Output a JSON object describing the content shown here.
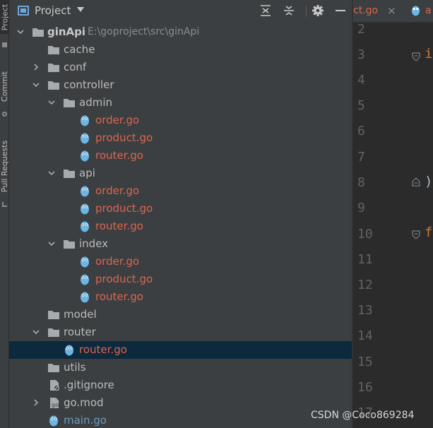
{
  "sidebar": {
    "tabs": [
      {
        "label": "Project",
        "active": true
      },
      {
        "label": "Commit",
        "active": false
      },
      {
        "label": "Pull Requests",
        "active": false
      }
    ]
  },
  "project_panel": {
    "title": "Project",
    "buttons": [
      "collapse-all",
      "expand-all",
      "settings",
      "hide"
    ]
  },
  "tree": {
    "root": {
      "name": "ginApi",
      "path": "E:\\goproject\\src\\ginApi"
    },
    "items": [
      {
        "name": "cache"
      },
      {
        "name": "conf"
      },
      {
        "name": "controller"
      },
      {
        "name": "admin"
      },
      {
        "name": "order.go"
      },
      {
        "name": "product.go"
      },
      {
        "name": "router.go"
      },
      {
        "name": "api"
      },
      {
        "name": "order.go"
      },
      {
        "name": "product.go"
      },
      {
        "name": "router.go"
      },
      {
        "name": "index"
      },
      {
        "name": "order.go"
      },
      {
        "name": "product.go"
      },
      {
        "name": "router.go"
      },
      {
        "name": "model"
      },
      {
        "name": "router"
      },
      {
        "name": "router.go",
        "selected": true
      },
      {
        "name": "utils"
      },
      {
        "name": ".gitignore"
      },
      {
        "name": "go.mod"
      },
      {
        "name": "main.go"
      }
    ]
  },
  "editor": {
    "tabs": [
      {
        "label": "ct.go",
        "close": "×"
      },
      {
        "label": "a"
      }
    ],
    "line_numbers": [
      "2",
      "3",
      "4",
      "5",
      "6",
      "7",
      "8",
      "9",
      "10",
      "11",
      "12",
      "13",
      "14",
      "15",
      "16",
      "17"
    ],
    "code_fragments": {
      "line3": "i",
      "line8": ")",
      "line10": "f"
    }
  },
  "watermark": "CSDN @Coco869284",
  "colors": {
    "panel_bg": "#3c3f41",
    "editor_bg": "#2b2b2b",
    "selection": "#0d293e",
    "go_file": "#d9664f",
    "unmodified_file": "#6d9cbe",
    "folder": "#a7abae",
    "gopher": "#6ab6e6"
  }
}
